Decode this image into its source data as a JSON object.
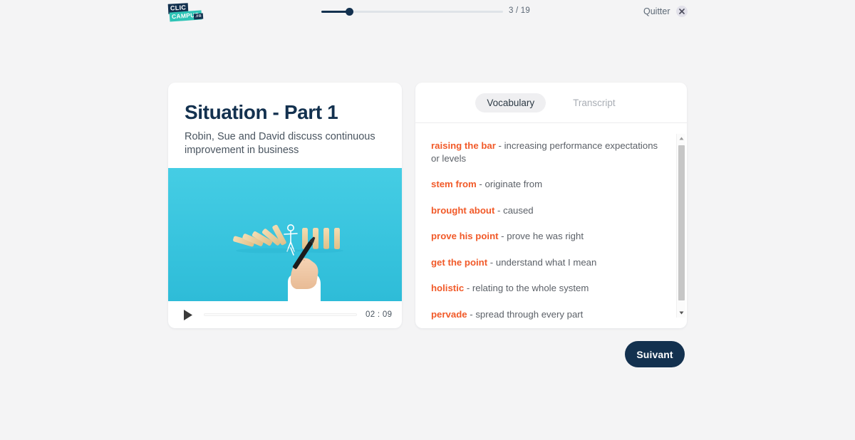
{
  "brand": {
    "logo_line1": "CLIC",
    "logo_line2": "CAMPUS",
    "logo_suffix": ".FR",
    "navy": "#13314f",
    "teal": "#2ec4b6",
    "accent_orange": "#f15a29"
  },
  "header": {
    "progress_current": 3,
    "progress_total": 19,
    "progress_label": "3 / 19",
    "quit_label": "Quitter",
    "close_icon": "close-icon"
  },
  "lesson": {
    "title": "Situation - Part 1",
    "subtitle": "Robin, Sue and David discuss continuous improvement in business"
  },
  "video": {
    "play_icon": "play-icon",
    "time_label": "02 : 09",
    "progress_percent": 0,
    "thumbnail_alt": "hand drawing a figure stopping falling dominoes on a turquoise background"
  },
  "panel": {
    "tabs": [
      {
        "label": "Vocabulary",
        "active": true
      },
      {
        "label": "Transcript",
        "active": false
      }
    ],
    "vocabulary": [
      {
        "term": "raising the bar",
        "separator": " - ",
        "definition": "increasing performance expectations or levels"
      },
      {
        "term": "stem from",
        "separator": " - ",
        "definition": "originate from"
      },
      {
        "term": "brought about",
        "separator": " - ",
        "definition": "caused"
      },
      {
        "term": "prove his point",
        "separator": " - ",
        "definition": "prove he was right"
      },
      {
        "term": "get the point",
        "separator": " - ",
        "definition": "understand what I mean"
      },
      {
        "term": "holistic",
        "separator": " - ",
        "definition": "relating to the whole system"
      },
      {
        "term": "pervade",
        "separator": " - ",
        "definition": "spread through every part"
      }
    ]
  },
  "footer": {
    "next_label": "Suivant"
  }
}
